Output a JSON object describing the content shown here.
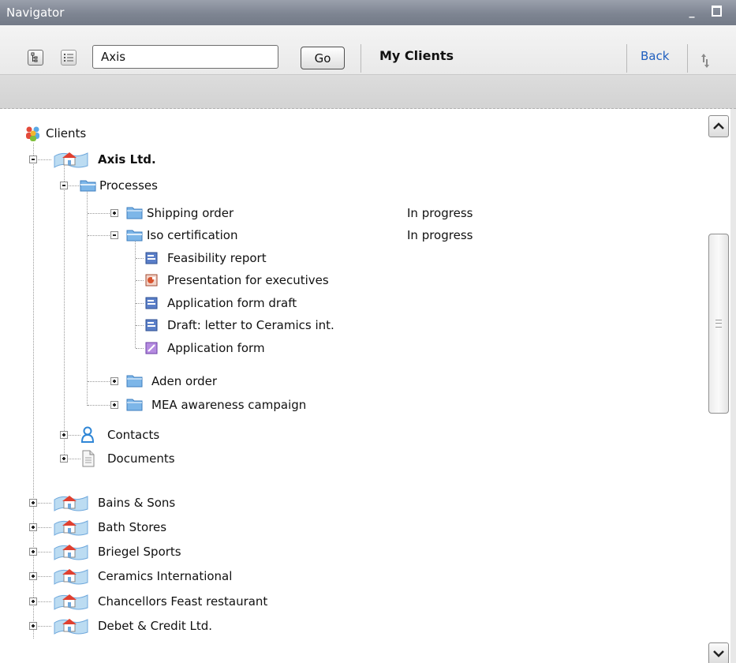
{
  "window": {
    "title": "Navigator",
    "minimize_glyph": "_",
    "maximize_icon": "maximize-icon"
  },
  "toolbar": {
    "search_value": "Axis",
    "go_label": "Go",
    "location_title": "My Clients",
    "back_label": "Back",
    "view_icons": [
      "tree-view-icon",
      "list-view-icon"
    ],
    "refresh_icon": "refresh-icon"
  },
  "tree": {
    "root": {
      "label": "Clients",
      "icon": "clients-group-icon"
    },
    "client_axis": {
      "label": "Axis Ltd.",
      "icon": "company-icon"
    },
    "processes": {
      "label": "Processes",
      "icon": "folder-open-icon"
    },
    "process_items": [
      {
        "label": "Shipping order",
        "status": "In progress"
      },
      {
        "label": "Iso certification",
        "status": "In progress"
      }
    ],
    "iso_children": [
      {
        "label": "Feasibility report",
        "icon": "word-doc-icon"
      },
      {
        "label": "Presentation for executives",
        "icon": "powerpoint-doc-icon"
      },
      {
        "label": "Application form draft",
        "icon": "word-doc-icon"
      },
      {
        "label": "Draft: letter to Ceramics int.",
        "icon": "word-doc-icon"
      },
      {
        "label": "Application form",
        "icon": "form-icon"
      }
    ],
    "more_processes": [
      {
        "label": "Aden order"
      },
      {
        "label": "MEA awareness campaign"
      }
    ],
    "axis_sections": [
      {
        "label": "Contacts",
        "icon": "contact-person-icon"
      },
      {
        "label": "Documents",
        "icon": "document-icon"
      }
    ],
    "clients": [
      {
        "label": "Bains & Sons"
      },
      {
        "label": "Bath Stores"
      },
      {
        "label": "Briegel Sports"
      },
      {
        "label": "Ceramics International"
      },
      {
        "label": "Chancellors Feast restaurant"
      },
      {
        "label": "Debet & Credit Ltd."
      }
    ]
  },
  "colors": {
    "titlebar": "#7e8592",
    "link": "#1f5fbf",
    "folder": "#6fa8dc"
  }
}
